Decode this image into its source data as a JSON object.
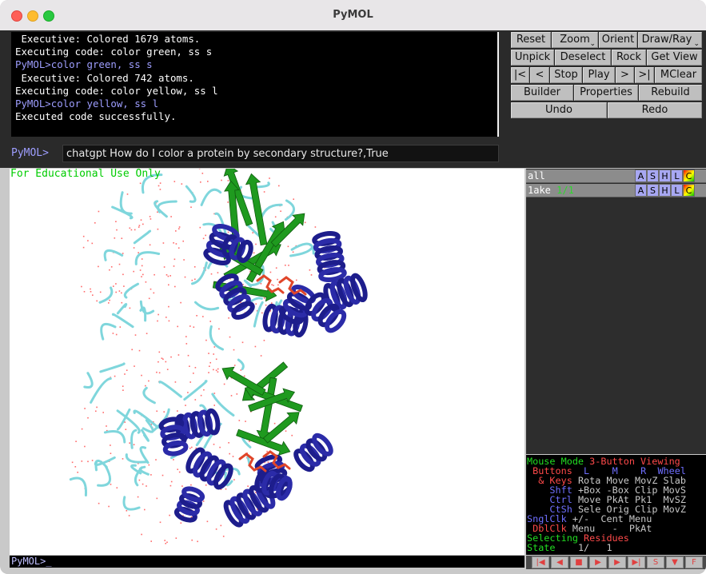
{
  "window": {
    "title": "PyMOL"
  },
  "console": {
    "lines": [
      {
        "text": " Executive: Colored 1679 atoms.",
        "kind": "output"
      },
      {
        "text": "Executing code: color green, ss s",
        "kind": "output"
      },
      {
        "text": "PyMOL>color green, ss s",
        "kind": "command"
      },
      {
        "text": " Executive: Colored 742 atoms.",
        "kind": "output"
      },
      {
        "text": "Executing code: color yellow, ss l",
        "kind": "output"
      },
      {
        "text": "PyMOL>color yellow, ss l",
        "kind": "command"
      },
      {
        "text": "Executed code successfully.",
        "kind": "output"
      }
    ]
  },
  "command_line": {
    "prompt": "PyMOL>",
    "value": "chatgpt How do I color a protein by secondary structure?,True"
  },
  "buttons": {
    "reset": "Reset",
    "zoom": "Zoom",
    "orient": "Orient",
    "draw_ray": "Draw/Ray",
    "unpick": "Unpick",
    "deselect": "Deselect",
    "rock": "Rock",
    "get_view": "Get View",
    "first_frame": "|<",
    "prev_frame": "<",
    "stop": "Stop",
    "play": "Play",
    "next_frame": ">",
    "last_frame": ">|",
    "mclear": "MClear",
    "builder": "Builder",
    "properties": "Properties",
    "rebuild": "Rebuild",
    "undo": "Undo",
    "redo": "Redo"
  },
  "viewer": {
    "watermark": "For Educational Use Only",
    "bottom_prompt": "PyMOL>_"
  },
  "objects": [
    {
      "name": "all",
      "state": "",
      "buttons": [
        "A",
        "S",
        "H",
        "L",
        "C"
      ]
    },
    {
      "name": "1ake",
      "state": "1/1",
      "buttons": [
        "A",
        "S",
        "H",
        "L",
        "C"
      ]
    }
  ],
  "mouse_panel": {
    "line1": {
      "label": "Mouse Mode",
      "mode": "3-Button Viewing"
    },
    "line2": {
      "label": "Buttons",
      "l": "L",
      "m": "M",
      "r": "R",
      "wheel": "Wheel"
    },
    "line3": {
      "key": "& Keys",
      "l": "Rota",
      "m": "Move",
      "r": "MovZ",
      "wheel": "Slab"
    },
    "line4": {
      "key": "Shft",
      "l": "+Box",
      "m": "-Box",
      "r": "Clip",
      "wheel": "MovS"
    },
    "line5": {
      "key": "Ctrl",
      "l": "Move",
      "m": "PkAt",
      "r": "Pk1",
      "wheel": "MvSZ"
    },
    "line6": {
      "key": "CtSh",
      "l": "Sele",
      "m": "Orig",
      "r": "Clip",
      "wheel": "MovZ"
    },
    "line7": {
      "key": "SnglClk",
      "l": "+/-",
      "m": "Cent",
      "r": "Menu"
    },
    "line8": {
      "key": "DblClk",
      "l": "Menu",
      "m": "-",
      "r": "PkAt"
    },
    "line9": {
      "label": "Selecting",
      "value": "Residues"
    },
    "line10": {
      "label": "State",
      "value": "1/",
      "total": "1"
    }
  },
  "transport": [
    "|◀",
    "◀",
    "■",
    "▶",
    "▶",
    "▶|",
    "S",
    "▼",
    "F"
  ],
  "colors": {
    "helix": "#1d1d8c",
    "sheet": "#1f9a1f",
    "loop": "#7fd6dc",
    "ligand": "#e0462a",
    "water": "#ff6a6a",
    "prompt_blue": "#9e9eff"
  }
}
